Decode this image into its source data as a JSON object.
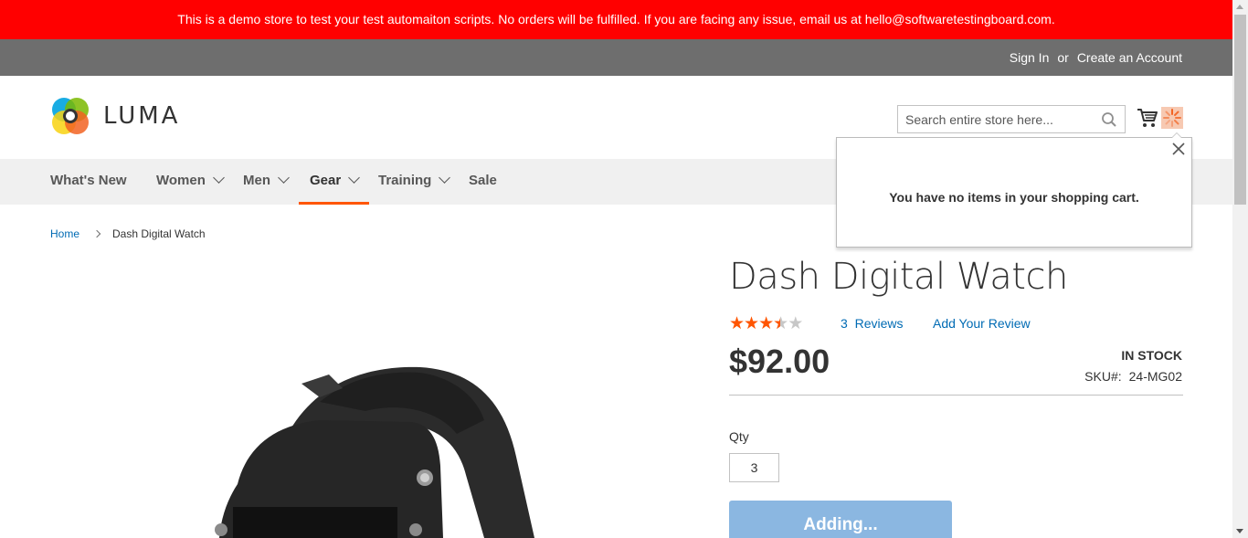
{
  "demo_banner": {
    "text": "This is a demo store to test your test automaiton scripts. No orders will be fulfilled. If you are facing any issue, email us at hello@softwaretestingboard.com."
  },
  "panel": {
    "sign_in": "Sign In",
    "or": "or",
    "create_account": "Create an Account"
  },
  "header": {
    "logo_text": "LUMA",
    "search_placeholder": "Search entire store here...",
    "search_icon": "search-icon",
    "cart_icon": "cart-icon",
    "loader_icon": "loader-icon"
  },
  "nav": {
    "items": [
      {
        "label": "What's New",
        "has_dropdown": false,
        "active": false
      },
      {
        "label": "Women",
        "has_dropdown": true,
        "active": false
      },
      {
        "label": "Men",
        "has_dropdown": true,
        "active": false
      },
      {
        "label": "Gear",
        "has_dropdown": true,
        "active": true
      },
      {
        "label": "Training",
        "has_dropdown": true,
        "active": false
      },
      {
        "label": "Sale",
        "has_dropdown": false,
        "active": false
      }
    ]
  },
  "breadcrumbs": {
    "home": "Home",
    "current": "Dash Digital Watch"
  },
  "product": {
    "title": "Dash Digital Watch",
    "rating_stars": 3.5,
    "rating_max": 5,
    "reviews_count": "3",
    "reviews_label": "Reviews",
    "add_review": "Add Your Review",
    "price": "$92.00",
    "stock": "In stock",
    "sku_label": "SKU#:",
    "sku_value": "24-MG02",
    "qty_label": "Qty",
    "qty_value": "3",
    "add_button": "Adding..."
  },
  "minicart": {
    "empty_message": "You have no items in your shopping cart.",
    "close_icon": "close-icon"
  },
  "colors": {
    "banner": "#ff0000",
    "panel": "#6e6e6e",
    "accent": "#ff5501",
    "link": "#006bb4",
    "button_disabled": "#8bb7e1"
  }
}
